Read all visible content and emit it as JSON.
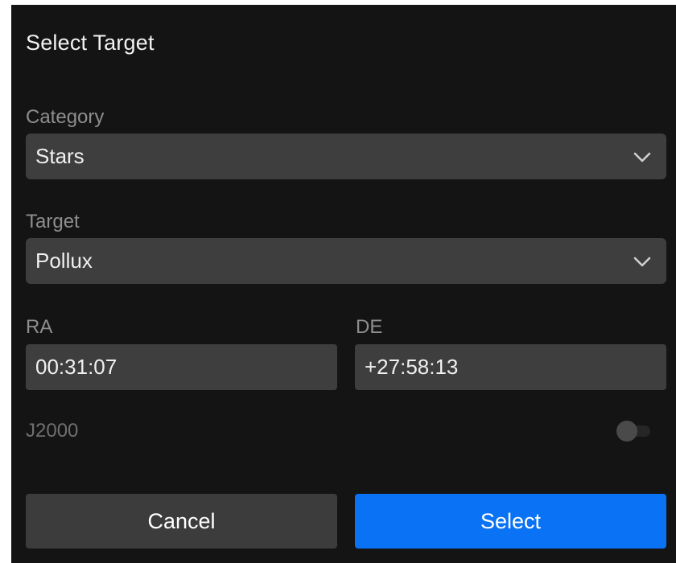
{
  "dialog": {
    "title": "Select Target"
  },
  "category": {
    "label": "Category",
    "selected": "Stars"
  },
  "target": {
    "label": "Target",
    "selected": "Pollux"
  },
  "coordinates": {
    "ra_label": "RA",
    "ra_value": "00:31:07",
    "de_label": "DE",
    "de_value": "+27:58:13"
  },
  "epoch": {
    "label": "J2000",
    "toggle_on": false
  },
  "buttons": {
    "cancel_label": "Cancel",
    "select_label": "Select"
  },
  "colors": {
    "background": "#141414",
    "field": "#3e3e3e",
    "accent": "#0a72f5",
    "muted_text": "#8e8e8e"
  },
  "icons": {
    "dropdown": "chevron-down-icon"
  }
}
